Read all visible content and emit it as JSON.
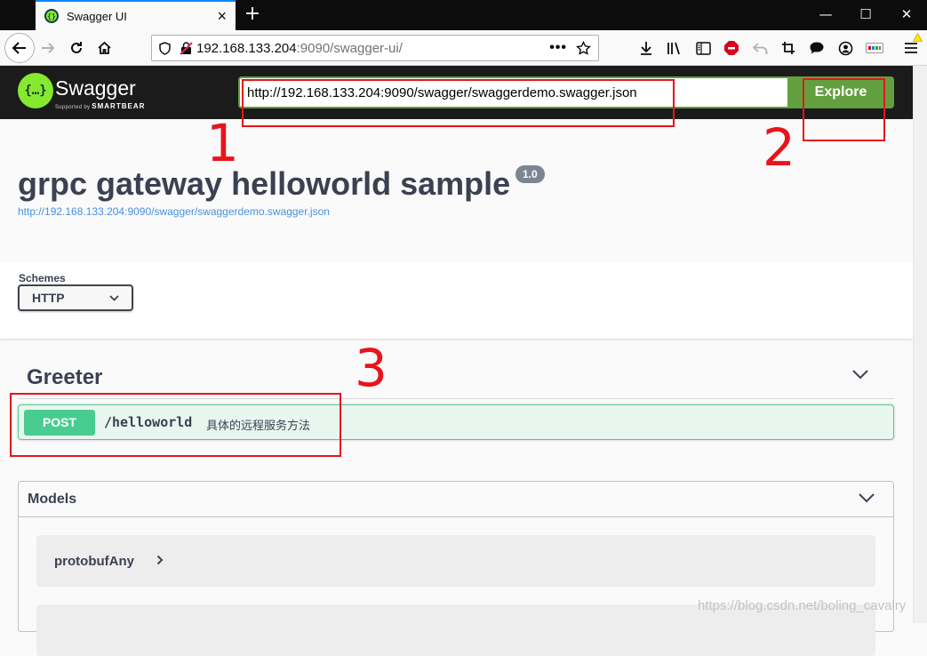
{
  "browser": {
    "tab_title": "Swagger UI",
    "url_host": "192.168.133.204",
    "url_rest": ":9090/swagger-ui/"
  },
  "swagger": {
    "brand": "Swagger",
    "supported_by": "Supported by",
    "smartbear": "SMARTBEAR",
    "spec_url": "http://192.168.133.204:9090/swagger/swaggerdemo.swagger.json",
    "explore_label": "Explore"
  },
  "info": {
    "title": "grpc gateway helloworld sample",
    "version": "1.0",
    "spec_link": "http://192.168.133.204:9090/swagger/swaggerdemo.swagger.json"
  },
  "schemes": {
    "label": "Schemes",
    "selected": "HTTP"
  },
  "operations": {
    "tag": "Greeter",
    "items": [
      {
        "method": "POST",
        "path": "/helloworld",
        "summary": "具体的远程服务方法"
      }
    ]
  },
  "models": {
    "title": "Models",
    "items": [
      {
        "name": "protobufAny"
      },
      {
        "name": ""
      }
    ]
  },
  "annotations": [
    "1",
    "2",
    "3"
  ],
  "watermark": "https://blog.csdn.net/boling_cavalry",
  "colors": {
    "swagger_green": "#62a03f",
    "post_green": "#49cc90",
    "annotation_red": "#e8141b",
    "topbar": "#1b1b1b"
  }
}
